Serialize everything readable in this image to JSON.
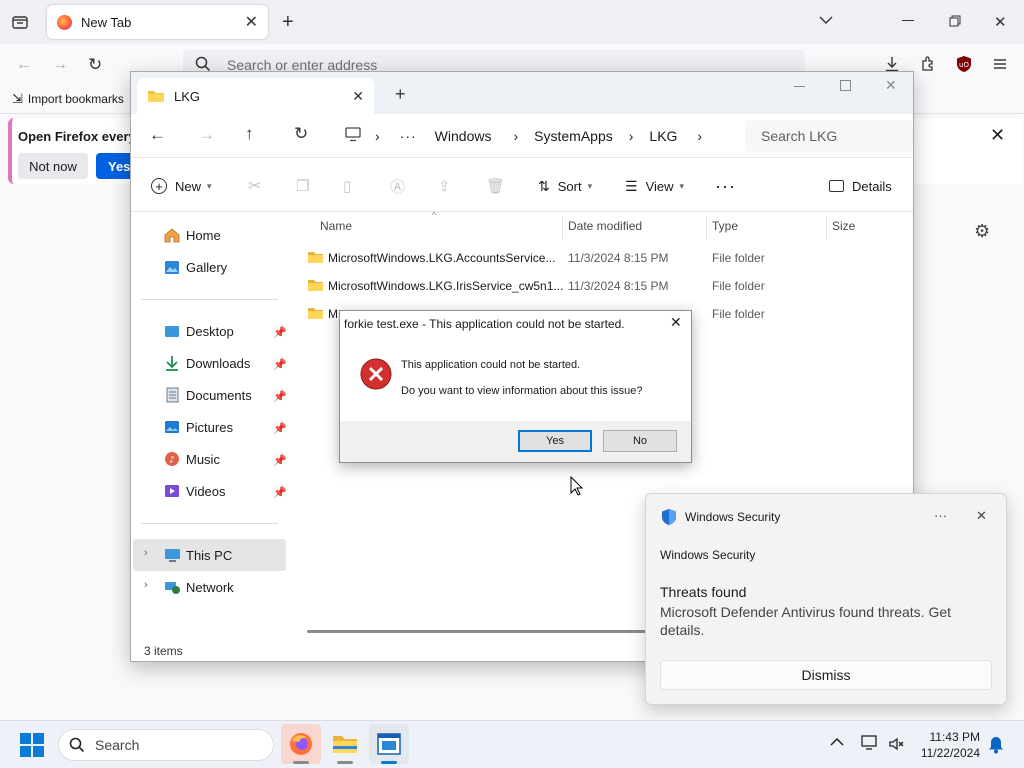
{
  "firefox": {
    "tab_title": "New Tab",
    "url_placeholder": "Search or enter address",
    "bookmarks_import": "Import bookmarks",
    "banner_text": "Open Firefox every",
    "not_now": "Not now",
    "yes": "Yes,"
  },
  "explorer": {
    "tab_title": "LKG",
    "breadcrumb": [
      "Windows",
      "SystemApps",
      "LKG"
    ],
    "search_placeholder": "Search LKG",
    "toolbar": {
      "new": "New",
      "sort": "Sort",
      "view": "View",
      "details": "Details"
    },
    "nav": {
      "home": "Home",
      "gallery": "Gallery",
      "desktop": "Desktop",
      "downloads": "Downloads",
      "documents": "Documents",
      "pictures": "Pictures",
      "music": "Music",
      "videos": "Videos",
      "this_pc": "This PC",
      "network": "Network"
    },
    "columns": {
      "name": "Name",
      "date": "Date modified",
      "type": "Type",
      "size": "Size"
    },
    "files": [
      {
        "name": "MicrosoftWindows.LKG.AccountsService...",
        "date": "11/3/2024 8:15 PM",
        "type": "File folder"
      },
      {
        "name": "MicrosoftWindows.LKG.IrisService_cw5n1...",
        "date": "11/3/2024 8:15 PM",
        "type": "File folder"
      },
      {
        "name": "M",
        "date": "",
        "type": "File folder"
      }
    ],
    "status": "3 items"
  },
  "dialog": {
    "title": "forkie test.exe - This application could not be started.",
    "line1": "This application could not be started.",
    "line2": "Do you want to view information about this issue?",
    "yes": "Yes",
    "no": "No"
  },
  "toast": {
    "app_name": "Windows Security",
    "sender": "Windows Security",
    "title": "Threats found",
    "message": "Microsoft Defender Antivirus found threats. Get details.",
    "dismiss": "Dismiss",
    "more": "···"
  },
  "taskbar": {
    "search": "Search",
    "time": "11:43 PM",
    "date": "11/22/2024"
  },
  "colors": {
    "accent": "#0078d4",
    "firefox_blue": "#0061e0",
    "error_red": "#d32f2f"
  }
}
